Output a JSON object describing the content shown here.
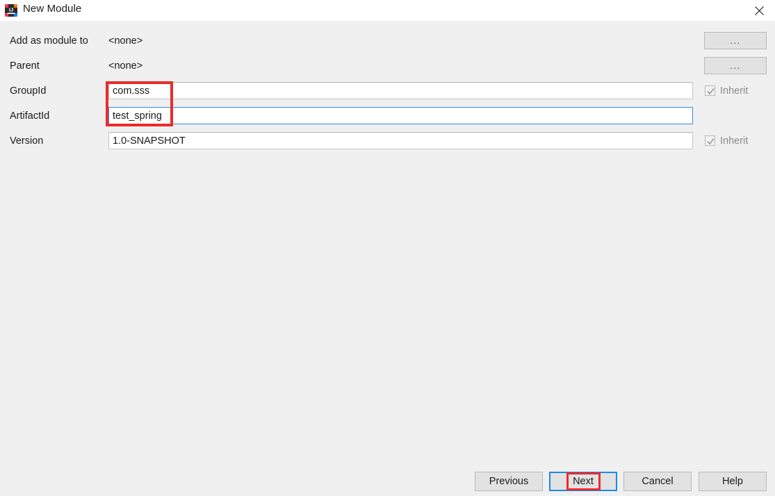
{
  "window": {
    "title": "New Module",
    "icon": "intellij-idea-icon",
    "close_label": "×"
  },
  "form": {
    "rows": [
      {
        "label": "Add as module to",
        "type": "static",
        "value": "<none>",
        "trailing": "browse",
        "browse_label": "..."
      },
      {
        "label": "Parent",
        "type": "static",
        "value": "<none>",
        "trailing": "browse",
        "browse_label": "..."
      },
      {
        "label": "GroupId",
        "type": "input",
        "value": "com.sss",
        "trailing": "inherit",
        "inherit_label": "Inherit",
        "inherit_checked": true,
        "inherit_enabled": false,
        "focused": false
      },
      {
        "label": "ArtifactId",
        "type": "input",
        "value": "test_spring",
        "trailing": "none",
        "focused": true
      },
      {
        "label": "Version",
        "type": "input",
        "value": "1.0-SNAPSHOT",
        "trailing": "inherit",
        "inherit_label": "Inherit",
        "inherit_checked": true,
        "inherit_enabled": false,
        "focused": false
      }
    ]
  },
  "buttons": {
    "previous": "Previous",
    "next": "Next",
    "cancel": "Cancel",
    "help": "Help"
  },
  "annotations": {
    "highlight_fields": "red-rectangle-groupid-artifactid",
    "highlight_next": "red-rectangle-next-button",
    "color": "#ec2b2b"
  },
  "colors": {
    "titlebar_bg": "#ffffff",
    "dialog_bg": "#f0f0f0",
    "field_bg": "#ffffff",
    "field_border": "#c4c4c4",
    "focus_blue": "#2d8ce0",
    "button_bg": "#e2e2e2",
    "disabled_text": "#8a8a8a",
    "annotation_red": "#ec2b2b"
  }
}
